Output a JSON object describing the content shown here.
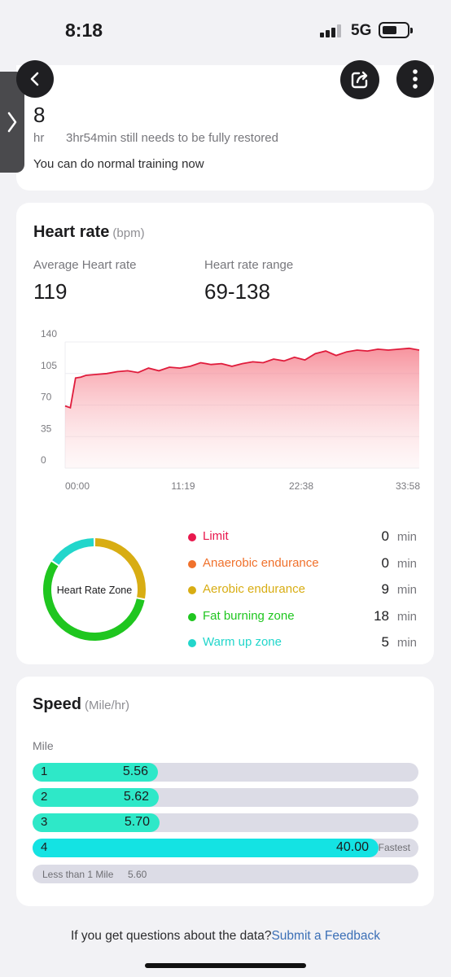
{
  "status_bar": {
    "time": "8:18",
    "network": "5G"
  },
  "recovery": {
    "value": "8",
    "unit": "hr",
    "remaining_text": "3hr54min still needs to be fully restored",
    "advice": "You can do normal training now"
  },
  "heart_rate": {
    "title": "Heart rate",
    "unit": "(bpm)",
    "average_label": "Average Heart rate",
    "average_value": "119",
    "range_label": "Heart rate range",
    "range_value": "69-138",
    "zone_center_label": "Heart Rate Zone",
    "zone_unit": "min",
    "zones": [
      {
        "label": "Limit",
        "value": "0",
        "color": "#e8184d"
      },
      {
        "label": "Anaerobic endurance",
        "value": "0",
        "color": "#f0712c"
      },
      {
        "label": "Aerobic endurance",
        "value": "9",
        "color": "#d8ad13"
      },
      {
        "label": "Fat burning zone",
        "value": "18",
        "color": "#1fc61f"
      },
      {
        "label": "Warm up zone",
        "value": "5",
        "color": "#22d6cb"
      }
    ]
  },
  "chart_data": {
    "type": "area",
    "title": "",
    "xlabel": "",
    "ylabel": "",
    "y_ticks": [
      "140",
      "105",
      "70",
      "35",
      "0"
    ],
    "x_ticks": [
      "00:00",
      "11:19",
      "22:38",
      "33:58"
    ],
    "ylim": [
      0,
      140
    ],
    "xlim": [
      0,
      33.97
    ],
    "x_unit": "minutes",
    "series": [
      {
        "color": "#e01c3c",
        "x": [
          0,
          0.5,
          1,
          1.5,
          2,
          3,
          4,
          5,
          6,
          7,
          8,
          9,
          10,
          11,
          12,
          13,
          14,
          15,
          16,
          17,
          18,
          19,
          20,
          21,
          22,
          23,
          24,
          25,
          26,
          27,
          28,
          29,
          30,
          31,
          32,
          33,
          33.97
        ],
        "values": [
          69,
          67,
          100,
          101,
          103,
          104,
          105,
          107,
          108,
          106,
          111,
          108,
          112,
          111,
          113,
          117,
          115,
          116,
          113,
          116,
          118,
          117,
          121,
          119,
          123,
          120,
          127,
          130,
          125,
          129,
          131,
          130,
          132,
          131,
          132,
          133,
          131
        ]
      }
    ]
  },
  "speed": {
    "title": "Speed",
    "unit": "(Mile/hr)",
    "mile_label": "Mile",
    "max_value": 43.5,
    "rows": [
      {
        "index": "1",
        "value": "5.56",
        "fraction": 0.325,
        "color": "#2ee8c8",
        "tag": ""
      },
      {
        "index": "2",
        "value": "5.62",
        "fraction": 0.328,
        "color": "#2ee8c8",
        "tag": ""
      },
      {
        "index": "3",
        "value": "5.70",
        "fraction": 0.33,
        "color": "#2ee8c8",
        "tag": ""
      },
      {
        "index": "4",
        "value": "40.00",
        "fraction": 0.896,
        "color": "#14e3e3",
        "tag": "Fastest"
      }
    ],
    "less_than_label": "Less than  1 Mile",
    "less_than_value": "5.60"
  },
  "footer": {
    "question": "If you get questions about the data?",
    "link": "Submit a Feedback"
  }
}
